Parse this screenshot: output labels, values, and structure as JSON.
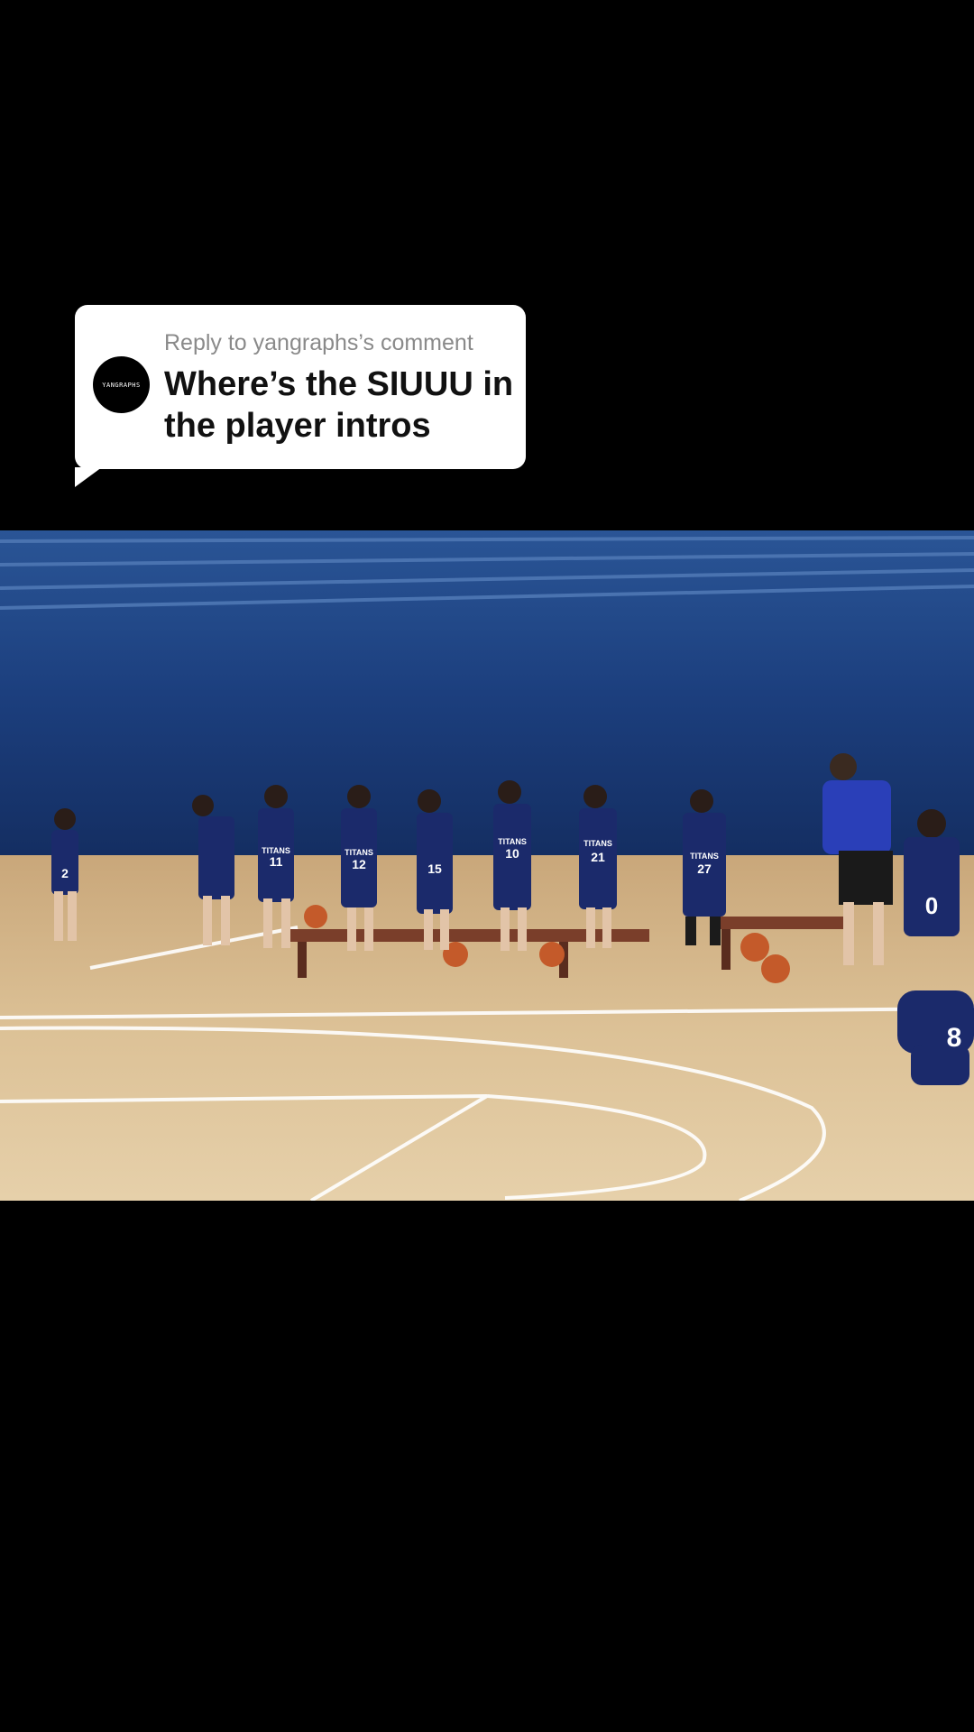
{
  "reply": {
    "label": "Reply to yangraphs’s comment",
    "text": "Where’s the SIUUU in the player intros",
    "avatar_text": "YANGRAPHS"
  },
  "video": {
    "description_icon": "basketball-court-scene",
    "jersey_numbers": [
      "2",
      "11",
      "12",
      "15",
      "10",
      "21",
      "27",
      "0",
      "8"
    ],
    "team_text": "TITANS"
  },
  "colors": {
    "background": "#000000",
    "bubble": "#ffffff",
    "wall": "#183a78",
    "floor": "#d8b98a",
    "jersey": "#1b2a6b"
  }
}
